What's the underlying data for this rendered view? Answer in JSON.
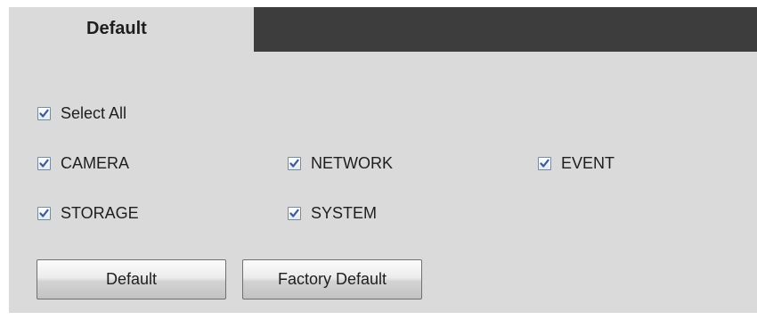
{
  "tab": {
    "label": "Default"
  },
  "options": {
    "select_all": {
      "label": "Select All",
      "checked": true
    },
    "camera": {
      "label": "CAMERA",
      "checked": true
    },
    "network": {
      "label": "NETWORK",
      "checked": true
    },
    "event": {
      "label": "EVENT",
      "checked": true
    },
    "storage": {
      "label": "STORAGE",
      "checked": true
    },
    "system": {
      "label": "SYSTEM",
      "checked": true
    }
  },
  "buttons": {
    "default_label": "Default",
    "factory_default_label": "Factory Default"
  },
  "colors": {
    "panel_background": "#dadada",
    "tab_bar": "#3d3d3d",
    "checkmark": "#3a5a9a"
  }
}
